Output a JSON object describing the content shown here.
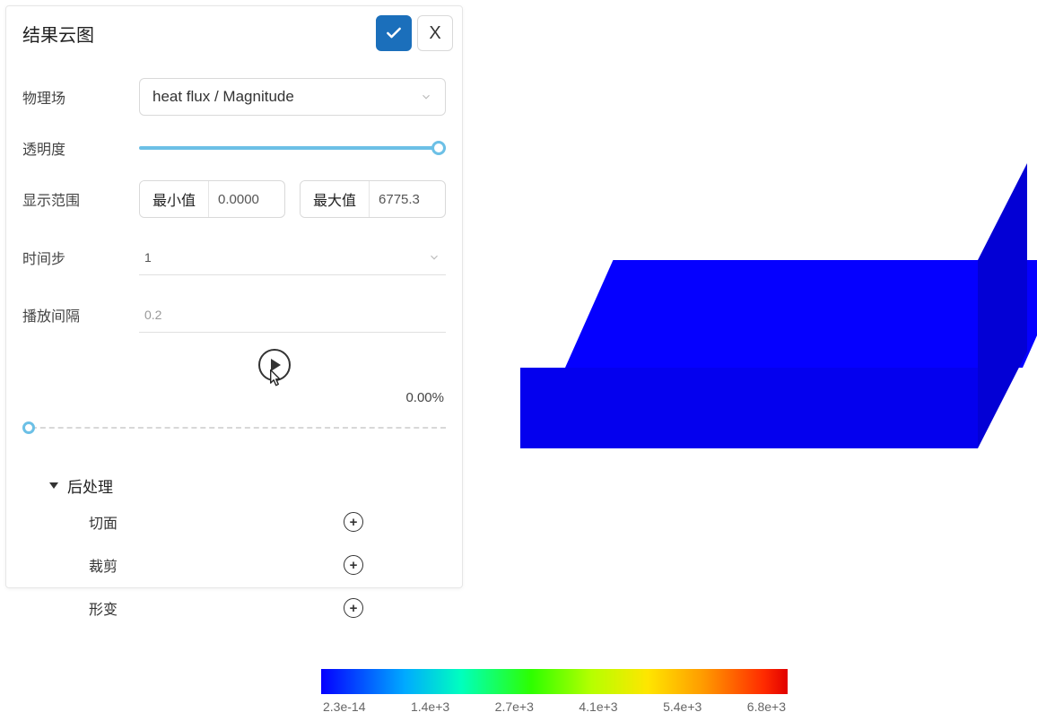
{
  "panel": {
    "title": "结果云图",
    "confirm_icon": "check",
    "close_label": "X",
    "physics_field_label": "物理场",
    "physics_field_value": "heat flux / Magnitude",
    "opacity_label": "透明度",
    "range_label": "显示范围",
    "min_label": "最小值",
    "min_value": "0.0000",
    "max_label": "最大值",
    "max_value": "6775.3",
    "timestep_label": "时间步",
    "timestep_value": "1",
    "interval_label": "播放间隔",
    "interval_value": "0.2",
    "progress": "0.00%",
    "postproc_header": "后处理",
    "items": [
      {
        "label": "切面"
      },
      {
        "label": "裁剪"
      },
      {
        "label": "形变"
      }
    ]
  },
  "colorbar": {
    "ticks": [
      "2.3e-14",
      "1.4e+3",
      "2.7e+3",
      "4.1e+3",
      "5.4e+3",
      "6.8e+3"
    ]
  }
}
